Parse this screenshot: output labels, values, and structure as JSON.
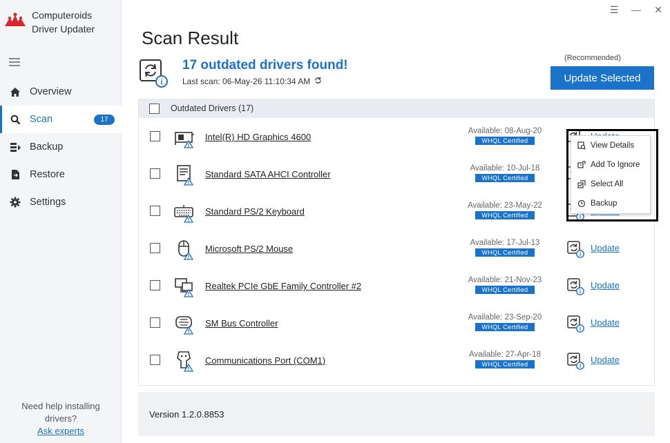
{
  "app": {
    "name_line1": "Computeroids",
    "name_line2": "Driver Updater"
  },
  "window_controls": {
    "menu": "☰",
    "minimize": "—",
    "close": "✕"
  },
  "sidebar": {
    "items": [
      {
        "label": "Overview",
        "icon": "home-icon"
      },
      {
        "label": "Scan",
        "icon": "search-icon",
        "badge": "17",
        "active": true
      },
      {
        "label": "Backup",
        "icon": "backup-icon"
      },
      {
        "label": "Restore",
        "icon": "restore-icon"
      },
      {
        "label": "Settings",
        "icon": "gear-icon"
      }
    ],
    "help_line1": "Need help installing",
    "help_line2": "drivers?",
    "help_link": "Ask experts"
  },
  "header": {
    "title": "Scan Result",
    "found": "17 outdated drivers found!",
    "last_scan": "Last scan: 06-May-26 11:10:34 AM",
    "recommended": "(Recommended)",
    "update_selected": "Update Selected"
  },
  "table": {
    "header_label": "Outdated Drivers  (17)",
    "whql": "WHQL Certified",
    "update_label": "Update",
    "rows": [
      {
        "name": "Intel(R) HD Graphics 4600",
        "available": "Available: 08-Aug-20",
        "icon": "graphics-card-icon"
      },
      {
        "name": "Standard SATA AHCI Controller",
        "available": "Available: 10-Jul-18",
        "icon": "storage-controller-icon"
      },
      {
        "name": "Standard PS/2 Keyboard",
        "available": "Available: 23-May-22",
        "icon": "keyboard-icon"
      },
      {
        "name": "Microsoft PS/2 Mouse",
        "available": "Available: 17-Jul-13",
        "icon": "mouse-icon"
      },
      {
        "name": "Realtek PCIe GbE Family Controller #2",
        "available": "Available: 21-Nov-23",
        "icon": "network-icon"
      },
      {
        "name": "SM Bus Controller",
        "available": "Available: 23-Sep-20",
        "icon": "bus-controller-icon"
      },
      {
        "name": "Communications Port (COM1)",
        "available": "Available: 27-Apr-18",
        "icon": "port-icon"
      }
    ]
  },
  "context_menu": {
    "items": [
      {
        "label": "View Details",
        "icon": "details-icon"
      },
      {
        "label": "Add To Ignore",
        "icon": "ignore-icon"
      },
      {
        "label": "Select All",
        "icon": "select-all-icon"
      },
      {
        "label": "Backup",
        "icon": "backup-icon"
      }
    ]
  },
  "footer": {
    "version": "Version 1.2.0.8853"
  },
  "colors": {
    "accent": "#1a73c8",
    "logo_red": "#d9262b",
    "sidebar_bg": "#f4f5f7"
  }
}
